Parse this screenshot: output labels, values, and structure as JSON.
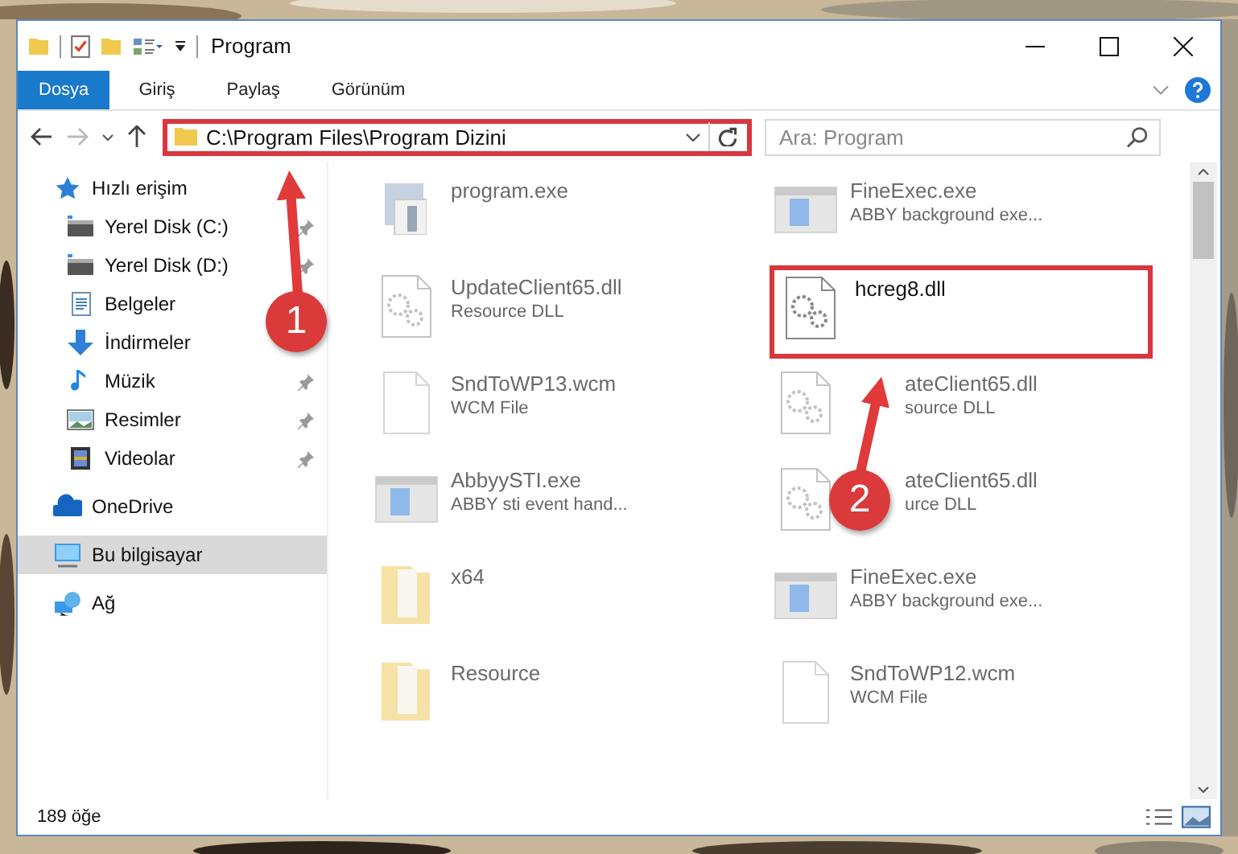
{
  "window": {
    "title": "Program"
  },
  "ribbon_tabs": [
    {
      "label": "Dosya",
      "selected": true
    },
    {
      "label": "Giriş",
      "selected": false
    },
    {
      "label": "Paylaş",
      "selected": false
    },
    {
      "label": "Görünüm",
      "selected": false
    }
  ],
  "address": {
    "path": "C:\\Program Files\\Program Dizini",
    "marked": true
  },
  "search": {
    "placeholder": "Ara: Program"
  },
  "sidebar": {
    "items": [
      {
        "label": "Hızlı erişim",
        "kind": "star",
        "selected": false,
        "children": [
          {
            "label": "Yerel Disk (C:)",
            "kind": "drive",
            "pinned": true,
            "selected": false
          },
          {
            "label": "Yerel Disk (D:)",
            "kind": "drive",
            "pinned": true,
            "selected": false
          },
          {
            "label": "Belgeler",
            "kind": "docs",
            "pinned": false,
            "selected": false
          },
          {
            "label": "İndirmeler",
            "kind": "download",
            "pinned": false,
            "selected": false
          },
          {
            "label": "Müzik",
            "kind": "music",
            "pinned": true,
            "selected": false
          },
          {
            "label": "Resimler",
            "kind": "pictures",
            "pinned": true,
            "selected": false
          },
          {
            "label": "Videolar",
            "kind": "videos",
            "pinned": true,
            "selected": false
          }
        ]
      },
      {
        "label": "OneDrive",
        "kind": "cloud",
        "selected": false
      },
      {
        "label": "Bu bilgisayar",
        "kind": "pc",
        "selected": true
      },
      {
        "label": "Ağ",
        "kind": "network",
        "selected": false
      }
    ]
  },
  "files": [
    {
      "name": "program.exe",
      "kind": "exe",
      "faded": true,
      "marked": false,
      "covered": false
    },
    {
      "name": "FineExec.exe",
      "type": "ABBY background exe...",
      "kind": "app",
      "faded": true,
      "marked": false,
      "covered": false
    },
    {
      "name": "UpdateClient65.dll",
      "type": "Resource DLL",
      "kind": "dll",
      "faded": true,
      "marked": false,
      "covered": false
    },
    {
      "name": "hcreg8.dll",
      "kind": "dll",
      "faded": false,
      "marked": true,
      "covered": false
    },
    {
      "name": "SndToWP13.wcm",
      "type": "WCM File",
      "kind": "file",
      "faded": true,
      "marked": false,
      "covered": false
    },
    {
      "name": "ateClient65.dll",
      "type": "source DLL",
      "kind": "dll",
      "faded": true,
      "marked": false,
      "covered": true
    },
    {
      "name": "AbbyySTI.exe",
      "type": "ABBY sti event hand...",
      "kind": "app",
      "faded": true,
      "marked": false,
      "covered": false
    },
    {
      "name": "ateClient65.dll",
      "type": "urce DLL",
      "kind": "dll",
      "faded": true,
      "marked": false,
      "covered": true
    },
    {
      "name": "x64",
      "kind": "folder",
      "faded": true,
      "marked": false,
      "covered": false
    },
    {
      "name": "FineExec.exe",
      "type": "ABBY background exe...",
      "kind": "app",
      "faded": true,
      "marked": false,
      "covered": false
    },
    {
      "name": "Resource",
      "kind": "folder",
      "faded": true,
      "marked": false,
      "covered": false
    },
    {
      "name": "SndToWP12.wcm",
      "type": "WCM File",
      "kind": "file",
      "faded": true,
      "marked": false,
      "covered": false
    }
  ],
  "status_bar": {
    "count": "189 öğe"
  },
  "annotations": [
    {
      "number": "1"
    },
    {
      "number": "2"
    }
  ]
}
